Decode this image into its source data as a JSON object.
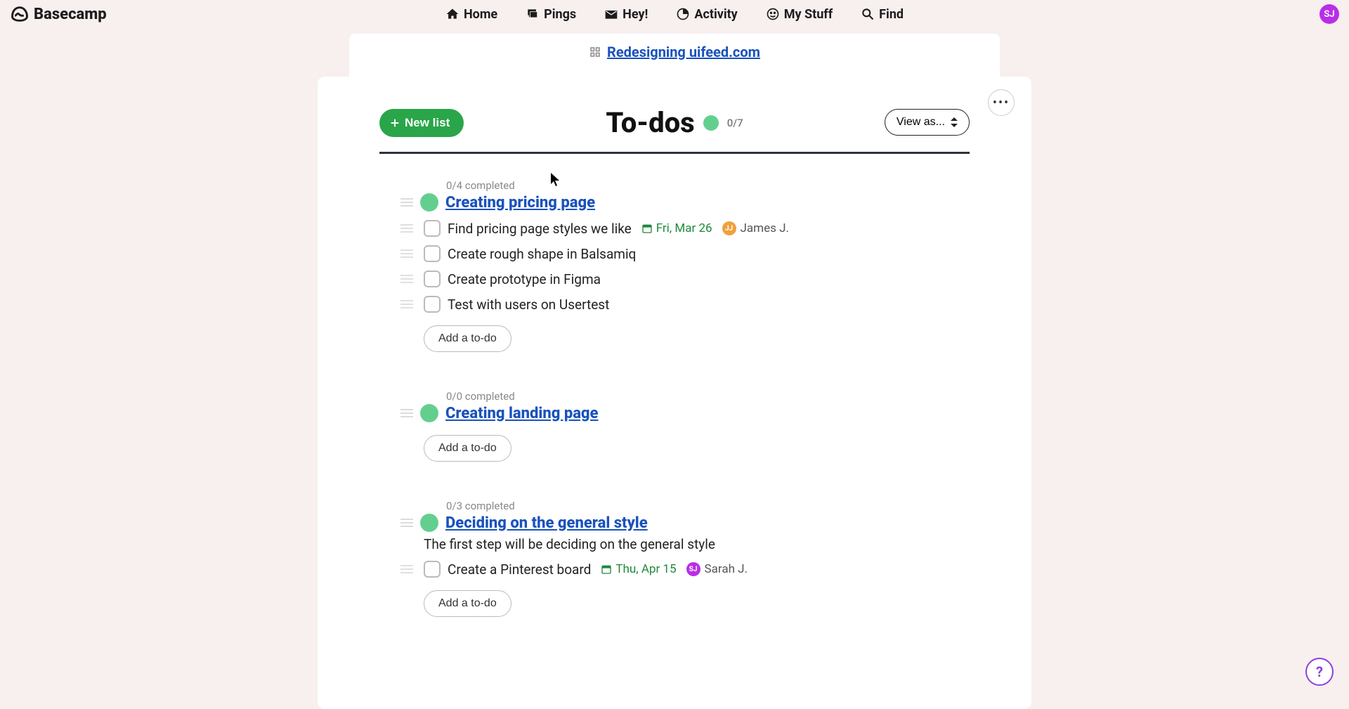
{
  "brand": "Basecamp",
  "nav": {
    "home": "Home",
    "pings": "Pings",
    "hey": "Hey!",
    "activity": "Activity",
    "mystuff": "My Stuff",
    "find": "Find"
  },
  "user_avatar_initials": "SJ",
  "breadcrumb": {
    "project": "Redesigning uifeed.com"
  },
  "page": {
    "title": "To-dos",
    "count": "0/7",
    "new_list_btn": "New list",
    "view_as_btn": "View as...",
    "more_label": "•••"
  },
  "add_todo_label": "Add a to-do",
  "lists": [
    {
      "completed": "0/4 completed",
      "title": "Creating pricing page",
      "desc": "",
      "todos": [
        {
          "text": "Find pricing page styles we like",
          "date": "Fri, Mar 26",
          "assignee": "James J.",
          "av_initials": "JJ",
          "av_class": "av-orange"
        },
        {
          "text": "Create rough shape in Balsamiq"
        },
        {
          "text": "Create prototype in Figma"
        },
        {
          "text": "Test with users on Usertest"
        }
      ]
    },
    {
      "completed": "0/0 completed",
      "title": "Creating landing page",
      "desc": "",
      "todos": []
    },
    {
      "completed": "0/3 completed",
      "title": "Deciding on the general style",
      "desc": "The first step will be deciding on the general style",
      "todos": [
        {
          "text": "Create a Pinterest board",
          "date": "Thu, Apr 15",
          "assignee": "Sarah J.",
          "av_initials": "SJ",
          "av_class": "av-purple"
        }
      ]
    }
  ],
  "help_label": "?"
}
